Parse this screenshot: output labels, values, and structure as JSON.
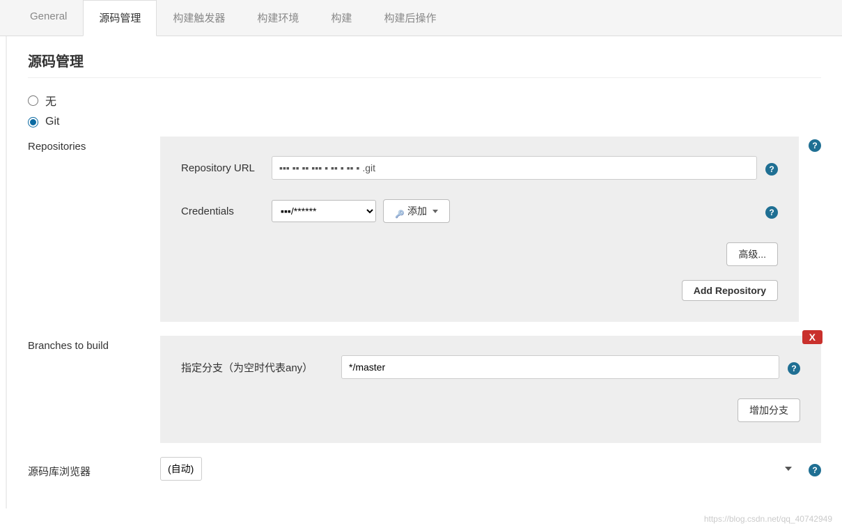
{
  "tabs": {
    "general": "General",
    "scm": "源码管理",
    "triggers": "构建触发器",
    "env": "构建环境",
    "build": "构建",
    "postbuild": "构建后操作"
  },
  "section": {
    "title": "源码管理",
    "radio_none": "无",
    "radio_git": "Git"
  },
  "repo": {
    "section_label": "Repositories",
    "url_label": "Repository URL",
    "url_value": "▪▪▪ ▪▪ ▪▪ ▪▪▪ ▪ ▪▪ ▪ ▪▪ ▪ .git",
    "cred_label": "Credentials",
    "cred_value": "▪▪▪/******",
    "add_cred": "添加",
    "advanced": "高级...",
    "add_repo": "Add Repository"
  },
  "branch": {
    "section_label": "Branches to build",
    "branch_label": "指定分支（为空时代表any）",
    "branch_value": "*/master",
    "add_branch": "增加分支",
    "delete": "X"
  },
  "browser": {
    "label": "源码库浏览器",
    "value": "(自动)"
  },
  "watermark": "https://blog.csdn.net/qq_40742949"
}
